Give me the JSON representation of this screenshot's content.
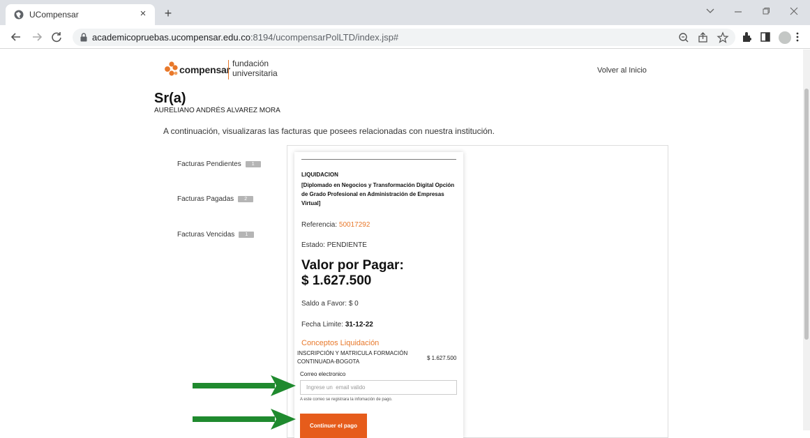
{
  "browser": {
    "tab_title": "UCompensar",
    "tab_close_glyph": "×",
    "new_tab_glyph": "+",
    "url_host": "academicopruebas.ucompensar.edu.co",
    "url_path": ":8194/ucompensarPolLTD/index.jsp#"
  },
  "header": {
    "logo_word": "compensar",
    "logo_line1": "fundación",
    "logo_line2": "universitaria",
    "back_home": "Volver al Inicio"
  },
  "user": {
    "greeting": "Sr(a)",
    "name": "AURELIANO ANDRÉS ALVAREZ MORA"
  },
  "intro_text": "A continuación, visualizaras las facturas que posees relacionadas con nuestra institución.",
  "sidebar": {
    "items": [
      {
        "label": "Facturas Pendientes",
        "count": "1"
      },
      {
        "label": "Facturas Pagadas",
        "count": "2"
      },
      {
        "label": "Facturas Vencidas",
        "count": "1"
      }
    ]
  },
  "invoice": {
    "type": "LIQUIDACION",
    "program": "[Diplomado en Negocios y Transformación Digital Opción de Grado Profesional en Administración de Empresas Virtual]",
    "reference_label": "Referencia: ",
    "reference_number": "50017292",
    "status": "Estado: PENDIENTE",
    "due_label": "Valor por Pagar:",
    "due_amount": "$ 1.627.500",
    "balance": "Saldo a Favor: $ 0",
    "deadline_label": "Fecha Limite: ",
    "deadline_value": "31-12-22",
    "concepts_title": "Conceptos Liquidación",
    "concepts": [
      {
        "name": "INSCRIPCIÓN Y MATRICULA FORMACIÓN CONTINUADA-BOGOTA",
        "amount": "$ 1.627.500"
      }
    ],
    "email_label": "Correo electronico",
    "email_placeholder": "Ingrese un  email valido",
    "email_value": "",
    "email_hint": "A este correo se registrara la infomación de pago.",
    "pay_button": "Continuer el pago"
  },
  "colors": {
    "accent": "#e8782a",
    "pay_button": "#e65c1b",
    "arrow": "#1f8a2e"
  }
}
